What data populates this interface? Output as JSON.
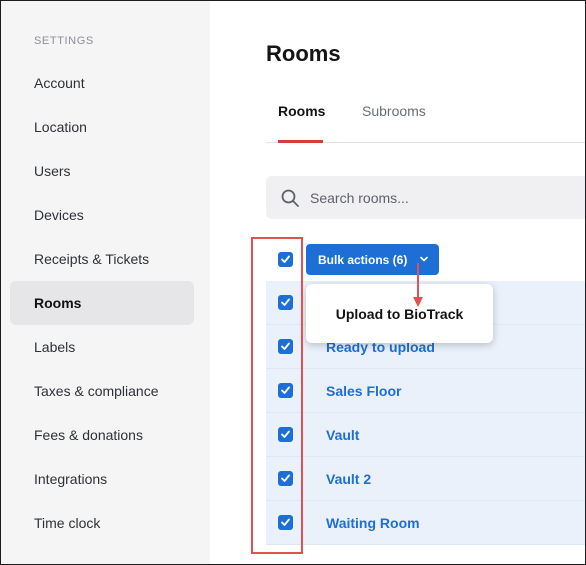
{
  "sidebar": {
    "heading": "SETTINGS",
    "items": [
      {
        "label": "Account"
      },
      {
        "label": "Location"
      },
      {
        "label": "Users"
      },
      {
        "label": "Devices"
      },
      {
        "label": "Receipts & Tickets"
      },
      {
        "label": "Rooms"
      },
      {
        "label": "Labels"
      },
      {
        "label": "Taxes & compliance"
      },
      {
        "label": "Fees & donations"
      },
      {
        "label": "Integrations"
      },
      {
        "label": "Time clock"
      }
    ],
    "active": "Rooms"
  },
  "main": {
    "title": "Rooms",
    "tabs": [
      {
        "label": "Rooms",
        "active": true
      },
      {
        "label": "Subrooms",
        "active": false
      }
    ],
    "search": {
      "placeholder": "Search rooms..."
    },
    "bulk_actions": {
      "label": "Bulk actions (6)",
      "selected_count": 6
    },
    "dropdown": {
      "item": "Upload to BioTrack"
    },
    "rooms": [
      {
        "name": "",
        "checked": true
      },
      {
        "name": "Ready to upload",
        "checked": true
      },
      {
        "name": "Sales Floor",
        "checked": true
      },
      {
        "name": "Vault",
        "checked": true
      },
      {
        "name": "Vault 2",
        "checked": true
      },
      {
        "name": "Waiting Room",
        "checked": true
      }
    ]
  },
  "colors": {
    "accent": "#1d6fd6",
    "tab_underline": "#d93a3a",
    "annotation": "#e05252",
    "sidebar_bg": "#f5f5f6",
    "row_bg": "#eaf1fb"
  },
  "icons": {
    "search": "search-icon",
    "check": "checkmark-icon",
    "chevron": "chevron-down-icon"
  }
}
